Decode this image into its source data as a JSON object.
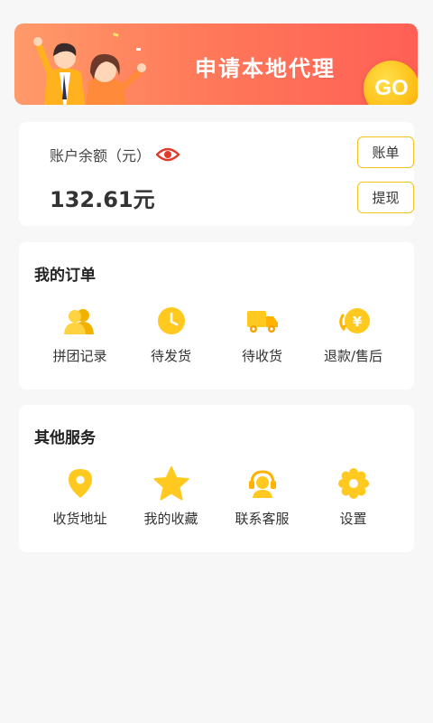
{
  "colors": {
    "accent": "#f9c41a",
    "banner_start": "#ff9a6a",
    "banner_end": "#ff5f55",
    "eye": "#e23a2a"
  },
  "banner": {
    "title": "申请本地代理",
    "go_label": "GO"
  },
  "balance": {
    "label": "账户余额（元）",
    "amount": "132.61元",
    "bill_button": "账单",
    "withdraw_button": "提现"
  },
  "orders": {
    "title": "我的订单",
    "items": [
      {
        "label": "拼团记录",
        "icon": "group-icon"
      },
      {
        "label": "待发货",
        "icon": "clock-icon"
      },
      {
        "label": "待收货",
        "icon": "truck-icon"
      },
      {
        "label": "退款/售后",
        "icon": "refund-icon"
      }
    ]
  },
  "services": {
    "title": "其他服务",
    "items": [
      {
        "label": "收货地址",
        "icon": "location-pin-icon"
      },
      {
        "label": "我的收藏",
        "icon": "star-icon"
      },
      {
        "label": "联系客服",
        "icon": "customer-service-icon"
      },
      {
        "label": "设置",
        "icon": "gear-icon"
      }
    ]
  }
}
